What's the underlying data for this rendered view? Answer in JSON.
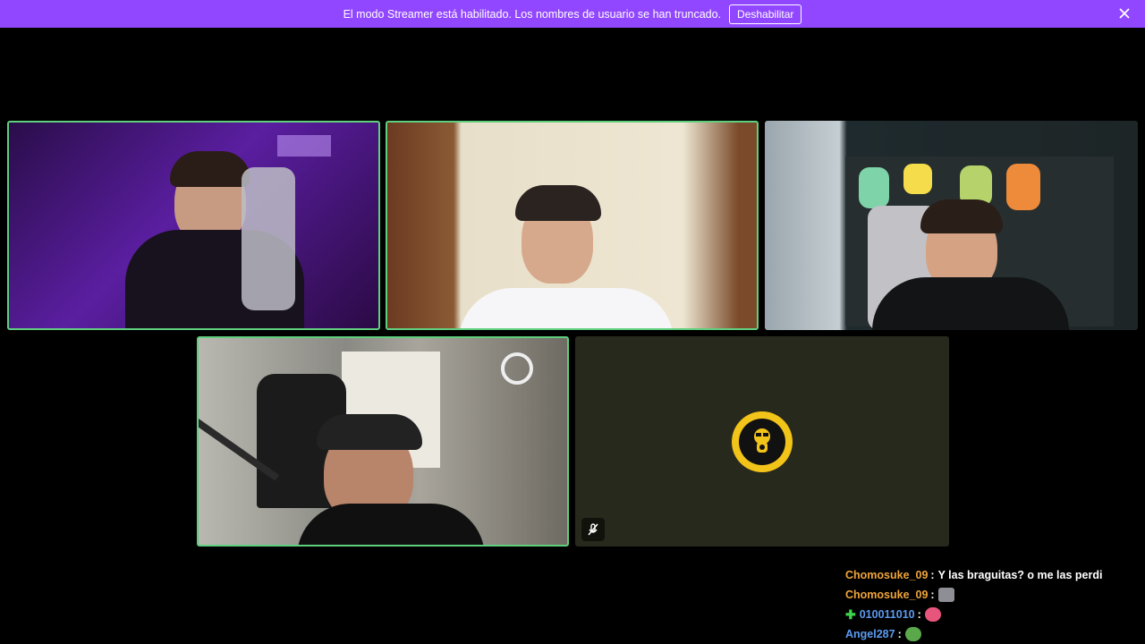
{
  "banner": {
    "text": "El modo Streamer está habilitado. Los nombres de usuario se han truncado.",
    "button_label": "Deshabilitar"
  },
  "colors": {
    "banner": "#9147ff",
    "active_border": "#5fcf7e",
    "avatar_ring": "#f2c318"
  },
  "tiles": [
    {
      "id": "tile-1",
      "active": true
    },
    {
      "id": "tile-2",
      "active": true
    },
    {
      "id": "tile-3",
      "active": false
    },
    {
      "id": "tile-4",
      "active": true
    },
    {
      "id": "tile-5",
      "active": false,
      "muted": true,
      "avatar": "gas-mask-avatar"
    }
  ],
  "chat": {
    "messages": [
      {
        "user": "Chomosuke_09",
        "user_color": "#f0a43a",
        "text": "Y las braguitas? o me las perdi",
        "emote": ""
      },
      {
        "user": "Chomosuke_09",
        "user_color": "#f0a43a",
        "text": "",
        "emote": "cat-emote"
      },
      {
        "user": "010011010",
        "user_color": "#5b9bf0",
        "text": "",
        "emote": "pink-emote",
        "badge": "plus-badge"
      },
      {
        "user": "Angel287",
        "user_color": "#5b9bf0",
        "text": "",
        "emote": "pepe-emote"
      }
    ]
  }
}
